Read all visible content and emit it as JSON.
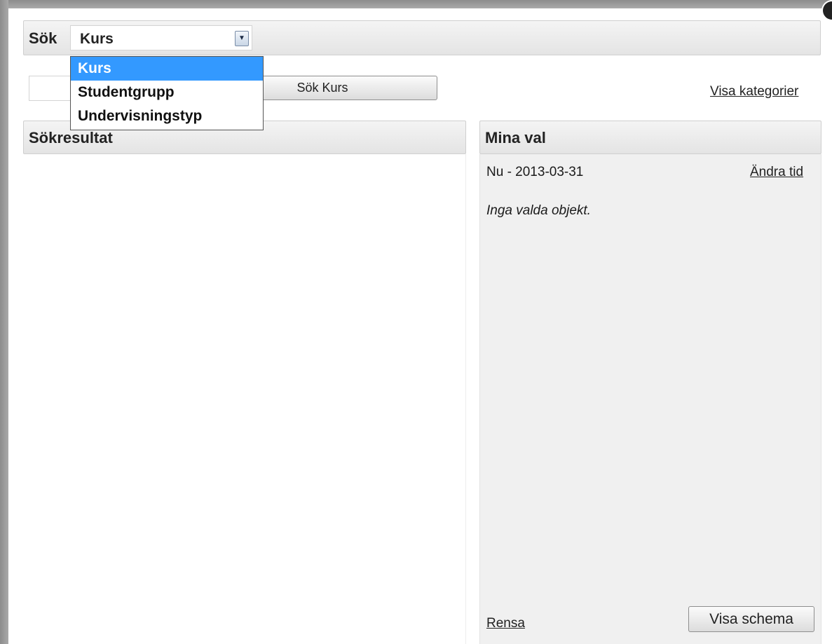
{
  "search": {
    "label": "Sök",
    "type_selected": "Kurs",
    "type_options": [
      "Kurs",
      "Studentgrupp",
      "Undervisningstyp"
    ],
    "query_value": "",
    "button_label": "Sök Kurs",
    "categories_link": "Visa kategorier"
  },
  "results": {
    "title": "Sökresultat"
  },
  "selections": {
    "title": "Mina val",
    "date_range": "Nu - 2013-03-31",
    "change_time_link": "Ändra tid",
    "empty_message": "Inga valda objekt.",
    "clear_link": "Rensa",
    "show_schedule_button": "Visa schema"
  },
  "icons": {
    "dropdown_arrow": "chevron-down-icon"
  }
}
